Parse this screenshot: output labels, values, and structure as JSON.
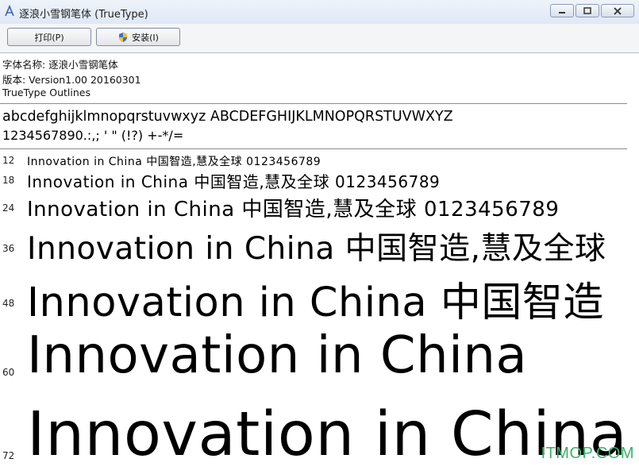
{
  "window": {
    "title": "逐浪小雪钢笔体 (TrueType)",
    "title_icon": "font-file-icon",
    "buttons": [
      "minimize-icon",
      "maximize-icon",
      "close-icon"
    ]
  },
  "toolbar": {
    "print_label": "打印(P)",
    "install_label": "安装(I)"
  },
  "font_info": {
    "name_line": "字体名称: 逐浪小雪钢笔体",
    "version_line": "版本: Version1.00 20160301",
    "outline_line": "TrueType Outlines"
  },
  "charset": {
    "line1": "abcdefghijklmnopqrstuvwxyz ABCDEFGHIJKLMNOPQRSTUVWXYZ",
    "line2": "1234567890.:,; ' \" (!?) +-*/="
  },
  "samples": [
    {
      "size": "12",
      "text": "Innovation in China 中国智造,慧及全球 0123456789"
    },
    {
      "size": "18",
      "text": "Innovation in China 中国智造,慧及全球 0123456789"
    },
    {
      "size": "24",
      "text": "Innovation in China 中国智造,慧及全球 0123456789"
    },
    {
      "size": "36",
      "text": "Innovation in China 中国智造,慧及全球"
    },
    {
      "size": "48",
      "text": "Innovation in China 中国智造"
    },
    {
      "size": "60",
      "text": "Innovation in China"
    },
    {
      "size": "72",
      "text": "Innovation in China"
    }
  ],
  "watermark": "ITMOP.COM",
  "colors": {
    "titlebar": "#dfe8f5",
    "watermark": "#39b36a"
  }
}
